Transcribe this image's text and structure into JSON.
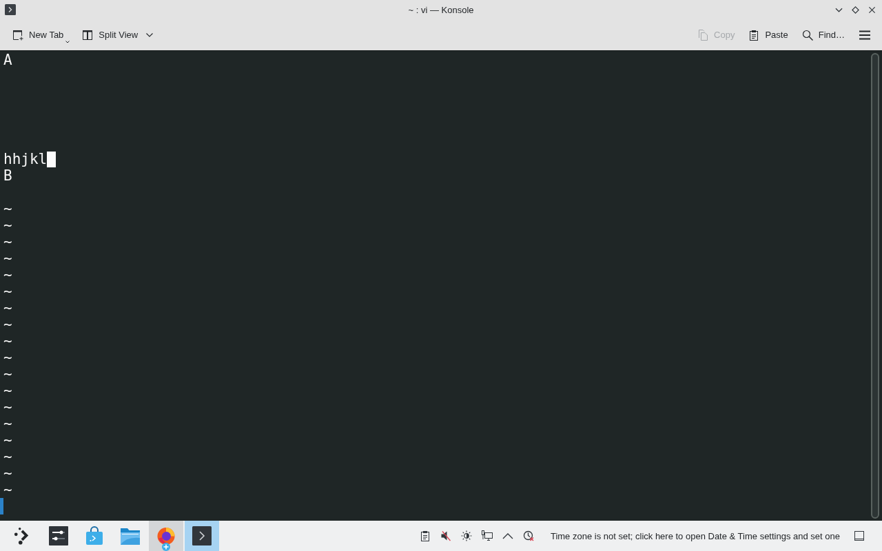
{
  "window": {
    "title": "~ : vi — Konsole"
  },
  "toolbar": {
    "left": [
      {
        "kind": "new-tab",
        "label": "New Tab",
        "disabled": false
      },
      {
        "kind": "split-view",
        "label": "Split View",
        "disabled": false
      }
    ],
    "right": [
      {
        "kind": "copy",
        "label": "Copy",
        "disabled": true
      },
      {
        "kind": "paste",
        "label": "Paste",
        "disabled": false
      },
      {
        "kind": "find",
        "label": "Find…",
        "disabled": false
      }
    ]
  },
  "terminal": {
    "lines": [
      {
        "kind": "text",
        "text": "A",
        "cursor": false
      },
      {
        "kind": "blank"
      },
      {
        "kind": "blank"
      },
      {
        "kind": "blank"
      },
      {
        "kind": "blank"
      },
      {
        "kind": "blank"
      },
      {
        "kind": "text",
        "text": "hhjkl",
        "cursor": true
      },
      {
        "kind": "text",
        "text": "B",
        "cursor": false
      },
      {
        "kind": "blank"
      },
      {
        "kind": "text",
        "text": "~",
        "cursor": false
      },
      {
        "kind": "text",
        "text": "~",
        "cursor": false
      },
      {
        "kind": "text",
        "text": "~",
        "cursor": false
      },
      {
        "kind": "text",
        "text": "~",
        "cursor": false
      },
      {
        "kind": "text",
        "text": "~",
        "cursor": false
      },
      {
        "kind": "text",
        "text": "~",
        "cursor": false
      },
      {
        "kind": "text",
        "text": "~",
        "cursor": false
      },
      {
        "kind": "text",
        "text": "~",
        "cursor": false
      },
      {
        "kind": "text",
        "text": "~",
        "cursor": false
      },
      {
        "kind": "text",
        "text": "~",
        "cursor": false
      },
      {
        "kind": "text",
        "text": "~",
        "cursor": false
      },
      {
        "kind": "text",
        "text": "~",
        "cursor": false
      },
      {
        "kind": "text",
        "text": "~",
        "cursor": false
      },
      {
        "kind": "text",
        "text": "~",
        "cursor": false
      },
      {
        "kind": "text",
        "text": "~",
        "cursor": false
      },
      {
        "kind": "text",
        "text": "~",
        "cursor": false
      },
      {
        "kind": "text",
        "text": "~",
        "cursor": false
      },
      {
        "kind": "text",
        "text": "~",
        "cursor": false
      },
      {
        "kind": "marker"
      }
    ]
  },
  "taskbar": {
    "tasks": [
      {
        "kind": "launcher",
        "selected": false,
        "hovered": false,
        "badge": false
      },
      {
        "kind": "settings",
        "selected": false,
        "hovered": false,
        "badge": false
      },
      {
        "kind": "store",
        "selected": false,
        "hovered": false,
        "badge": false
      },
      {
        "kind": "files",
        "selected": false,
        "hovered": false,
        "badge": false
      },
      {
        "kind": "browser",
        "selected": false,
        "hovered": true,
        "badge": true
      },
      {
        "kind": "terminal",
        "selected": true,
        "hovered": false,
        "badge": false
      }
    ],
    "tray": [
      {
        "kind": "clipboard"
      },
      {
        "kind": "volume",
        "muted": true
      },
      {
        "kind": "brightness"
      },
      {
        "kind": "network"
      },
      {
        "kind": "expand"
      },
      {
        "kind": "clock"
      }
    ],
    "notice": "Time zone is not set; click here to open Date & Time settings and set one"
  }
}
